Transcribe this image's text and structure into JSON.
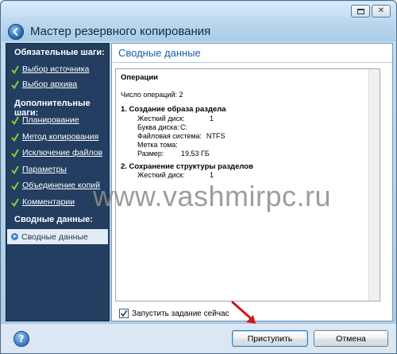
{
  "window": {
    "title": "Мастер резервного копирования"
  },
  "sidebar": {
    "required_header": "Обязательные шаги:",
    "required_steps": [
      {
        "label": "Выбор источника",
        "icon": "check-icon"
      },
      {
        "label": "Выбор архива",
        "icon": "check-icon"
      }
    ],
    "optional_header": "Дополнительные шаги:",
    "optional_steps": [
      {
        "label": "Планирование",
        "icon": "check-icon"
      },
      {
        "label": "Метод копирования",
        "icon": "check-icon"
      },
      {
        "label": "Исключение файлов",
        "icon": "check-icon"
      },
      {
        "label": "Параметры",
        "icon": "check-icon"
      },
      {
        "label": "Объединение копий",
        "icon": "check-icon"
      },
      {
        "label": "Комментарии",
        "icon": "check-icon"
      }
    ],
    "summary_header": "Сводные данные:",
    "summary_step": {
      "label": "Сводные данные",
      "icon": "arrow-right-icon"
    }
  },
  "main": {
    "title": "Сводные данные",
    "operations_header": "Операции",
    "operations_count": "Число операций: 2",
    "op1": {
      "title": "1. Создание образа раздела",
      "rows": [
        {
          "key": "Жесткий диск:",
          "value": "1"
        },
        {
          "key": "Буква диска:",
          "value": "C:"
        },
        {
          "key": "Файловая система:",
          "value": "NTFS"
        },
        {
          "key": "Метка тома:",
          "value": ""
        },
        {
          "key": "Размер:",
          "value": "19,53 ГБ"
        }
      ]
    },
    "op2": {
      "title": "2. Сохранение структуры разделов",
      "rows": [
        {
          "key": "Жесткий диск:",
          "value": "1"
        }
      ]
    },
    "run_now_label": "Запустить задание сейчас",
    "run_now_checked": true
  },
  "buttons": {
    "proceed": "Приступить",
    "cancel": "Отмена"
  },
  "watermark": "www.vashmirpc.ru",
  "colors": {
    "sidebar_bg": "#233e60",
    "title_accent": "#1c5ea8",
    "arrow_annotation": "#d01818"
  }
}
